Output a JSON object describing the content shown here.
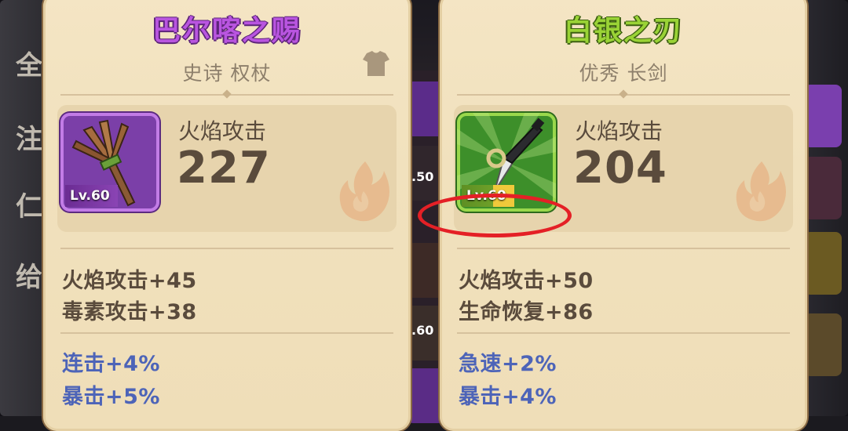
{
  "background": {
    "left_letters": [
      "全",
      "注",
      "仁",
      "给"
    ],
    "mid_labels": [
      ".50",
      ".60"
    ]
  },
  "cards": [
    {
      "title": "巴尔喀之赐",
      "title_color": "#b955e0",
      "subtitle": "史诗 权杖",
      "icon": "staff-icon",
      "level": "Lv.60",
      "main_stat_name": "火焰攻击",
      "main_stat_value": "227",
      "attributes": [
        "火焰攻击+45",
        "毒素攻击+38"
      ],
      "bonuses": [
        "连击+4%",
        "暴击+5%"
      ]
    },
    {
      "title": "白银之刃",
      "title_color": "#9ad336",
      "subtitle": "优秀 长剑",
      "icon": "sword-icon",
      "level": "Lv.60",
      "main_stat_name": "火焰攻击",
      "main_stat_value": "204",
      "attributes": [
        "火焰攻击+50",
        "生命恢复+86"
      ],
      "bonuses": [
        "急速+2%",
        "暴击+4%"
      ]
    }
  ],
  "colors": {
    "parchment": "#f2e2bf",
    "epic_purple": "#b955e0",
    "uncommon_green": "#9ad336",
    "bonus_blue": "#4d64b8",
    "highlight_red": "#e42026"
  }
}
